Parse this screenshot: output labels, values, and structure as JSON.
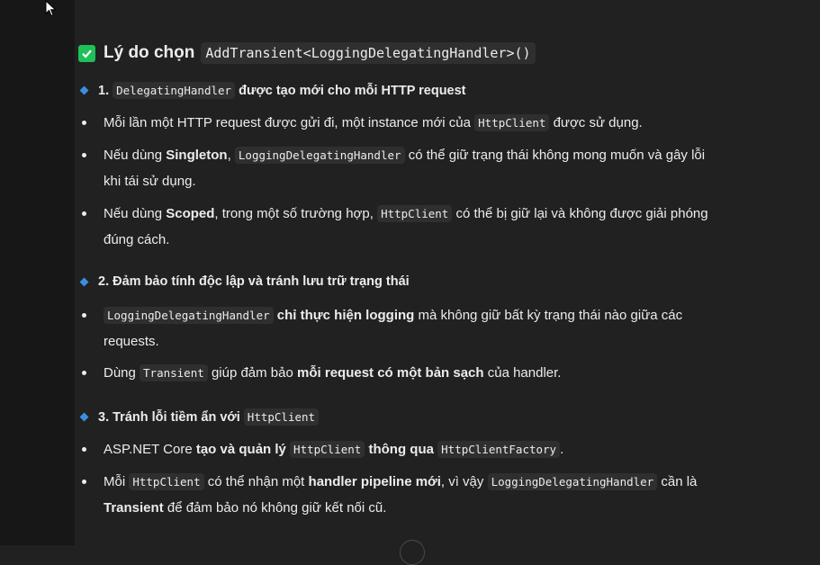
{
  "heading": {
    "prefix": "Lý do chọn",
    "code": "AddTransient<LoggingDelegatingHandler>()"
  },
  "sections": [
    {
      "title_num": "1.",
      "title_code": "DelegatingHandler",
      "title_rest": "được tạo mới cho mỗi HTTP request",
      "items": [
        {
          "t1": "Mỗi lần một HTTP request được gửi đi, một instance mới của",
          "c1": "HttpClient",
          "t2": "được sử dụng."
        },
        {
          "t1": "Nếu dùng",
          "b1": "Singleton",
          "t2": ",",
          "c1": "LoggingDelegatingHandler",
          "t3": "có thể giữ trạng thái không mong muốn và gây lỗi khi tái sử dụng."
        },
        {
          "t1": "Nếu dùng",
          "b1": "Scoped",
          "t2": ", trong một số trường hợp,",
          "c1": "HttpClient",
          "t3": "có thể bị giữ lại và không được giải phóng đúng cách."
        }
      ]
    },
    {
      "title": "2. Đảm bảo tính độc lập và tránh lưu trữ trạng thái",
      "items": [
        {
          "c1": "LoggingDelegatingHandler",
          "b1": "chỉ thực hiện logging",
          "t1": "mà không giữ bất kỳ trạng thái nào giữa các requests."
        },
        {
          "t1": "Dùng",
          "c1": "Transient",
          "t2": "giúp đảm bảo",
          "b1": "mỗi request có một bản sạch",
          "t3": "của handler."
        }
      ]
    },
    {
      "title": "3. Tránh lỗi tiềm ẩn với",
      "title_code": "HttpClient",
      "items": [
        {
          "t1": "ASP.NET Core",
          "b1": "tạo và quản lý",
          "c1": "HttpClient",
          "b2": "thông qua",
          "c2": "HttpClientFactory",
          "t2": "."
        },
        {
          "t1": "Mỗi",
          "c1": "HttpClient",
          "t2": "có thể nhận một",
          "b1": "handler pipeline mới",
          "t3": ", vì vậy",
          "c2": "LoggingDelegatingHandler",
          "t4": "cần là",
          "b2": "Transient",
          "t5": "để đảm bảo nó không giữ kết nối cũ."
        }
      ]
    }
  ],
  "colors": {
    "background": "#212121",
    "check": "#1fbf5a",
    "diamond": "#3b8fe0",
    "code_bg": "#2f2f2f"
  }
}
